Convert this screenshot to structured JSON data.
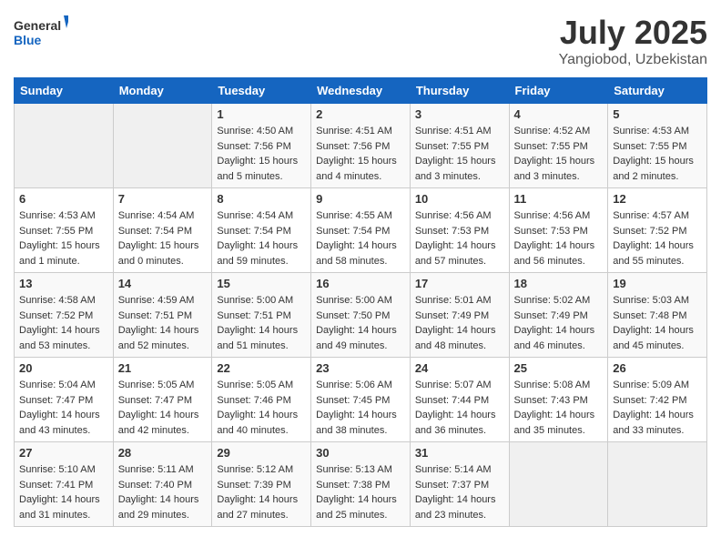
{
  "header": {
    "logo_line1": "General",
    "logo_line2": "Blue",
    "month": "July 2025",
    "location": "Yangiobod, Uzbekistan"
  },
  "days_of_week": [
    "Sunday",
    "Monday",
    "Tuesday",
    "Wednesday",
    "Thursday",
    "Friday",
    "Saturday"
  ],
  "weeks": [
    [
      {
        "day": "",
        "empty": true
      },
      {
        "day": "",
        "empty": true
      },
      {
        "day": "1",
        "sunrise": "Sunrise: 4:50 AM",
        "sunset": "Sunset: 7:56 PM",
        "daylight": "Daylight: 15 hours and 5 minutes."
      },
      {
        "day": "2",
        "sunrise": "Sunrise: 4:51 AM",
        "sunset": "Sunset: 7:56 PM",
        "daylight": "Daylight: 15 hours and 4 minutes."
      },
      {
        "day": "3",
        "sunrise": "Sunrise: 4:51 AM",
        "sunset": "Sunset: 7:55 PM",
        "daylight": "Daylight: 15 hours and 3 minutes."
      },
      {
        "day": "4",
        "sunrise": "Sunrise: 4:52 AM",
        "sunset": "Sunset: 7:55 PM",
        "daylight": "Daylight: 15 hours and 3 minutes."
      },
      {
        "day": "5",
        "sunrise": "Sunrise: 4:53 AM",
        "sunset": "Sunset: 7:55 PM",
        "daylight": "Daylight: 15 hours and 2 minutes."
      }
    ],
    [
      {
        "day": "6",
        "sunrise": "Sunrise: 4:53 AM",
        "sunset": "Sunset: 7:55 PM",
        "daylight": "Daylight: 15 hours and 1 minute."
      },
      {
        "day": "7",
        "sunrise": "Sunrise: 4:54 AM",
        "sunset": "Sunset: 7:54 PM",
        "daylight": "Daylight: 15 hours and 0 minutes."
      },
      {
        "day": "8",
        "sunrise": "Sunrise: 4:54 AM",
        "sunset": "Sunset: 7:54 PM",
        "daylight": "Daylight: 14 hours and 59 minutes."
      },
      {
        "day": "9",
        "sunrise": "Sunrise: 4:55 AM",
        "sunset": "Sunset: 7:54 PM",
        "daylight": "Daylight: 14 hours and 58 minutes."
      },
      {
        "day": "10",
        "sunrise": "Sunrise: 4:56 AM",
        "sunset": "Sunset: 7:53 PM",
        "daylight": "Daylight: 14 hours and 57 minutes."
      },
      {
        "day": "11",
        "sunrise": "Sunrise: 4:56 AM",
        "sunset": "Sunset: 7:53 PM",
        "daylight": "Daylight: 14 hours and 56 minutes."
      },
      {
        "day": "12",
        "sunrise": "Sunrise: 4:57 AM",
        "sunset": "Sunset: 7:52 PM",
        "daylight": "Daylight: 14 hours and 55 minutes."
      }
    ],
    [
      {
        "day": "13",
        "sunrise": "Sunrise: 4:58 AM",
        "sunset": "Sunset: 7:52 PM",
        "daylight": "Daylight: 14 hours and 53 minutes."
      },
      {
        "day": "14",
        "sunrise": "Sunrise: 4:59 AM",
        "sunset": "Sunset: 7:51 PM",
        "daylight": "Daylight: 14 hours and 52 minutes."
      },
      {
        "day": "15",
        "sunrise": "Sunrise: 5:00 AM",
        "sunset": "Sunset: 7:51 PM",
        "daylight": "Daylight: 14 hours and 51 minutes."
      },
      {
        "day": "16",
        "sunrise": "Sunrise: 5:00 AM",
        "sunset": "Sunset: 7:50 PM",
        "daylight": "Daylight: 14 hours and 49 minutes."
      },
      {
        "day": "17",
        "sunrise": "Sunrise: 5:01 AM",
        "sunset": "Sunset: 7:49 PM",
        "daylight": "Daylight: 14 hours and 48 minutes."
      },
      {
        "day": "18",
        "sunrise": "Sunrise: 5:02 AM",
        "sunset": "Sunset: 7:49 PM",
        "daylight": "Daylight: 14 hours and 46 minutes."
      },
      {
        "day": "19",
        "sunrise": "Sunrise: 5:03 AM",
        "sunset": "Sunset: 7:48 PM",
        "daylight": "Daylight: 14 hours and 45 minutes."
      }
    ],
    [
      {
        "day": "20",
        "sunrise": "Sunrise: 5:04 AM",
        "sunset": "Sunset: 7:47 PM",
        "daylight": "Daylight: 14 hours and 43 minutes."
      },
      {
        "day": "21",
        "sunrise": "Sunrise: 5:05 AM",
        "sunset": "Sunset: 7:47 PM",
        "daylight": "Daylight: 14 hours and 42 minutes."
      },
      {
        "day": "22",
        "sunrise": "Sunrise: 5:05 AM",
        "sunset": "Sunset: 7:46 PM",
        "daylight": "Daylight: 14 hours and 40 minutes."
      },
      {
        "day": "23",
        "sunrise": "Sunrise: 5:06 AM",
        "sunset": "Sunset: 7:45 PM",
        "daylight": "Daylight: 14 hours and 38 minutes."
      },
      {
        "day": "24",
        "sunrise": "Sunrise: 5:07 AM",
        "sunset": "Sunset: 7:44 PM",
        "daylight": "Daylight: 14 hours and 36 minutes."
      },
      {
        "day": "25",
        "sunrise": "Sunrise: 5:08 AM",
        "sunset": "Sunset: 7:43 PM",
        "daylight": "Daylight: 14 hours and 35 minutes."
      },
      {
        "day": "26",
        "sunrise": "Sunrise: 5:09 AM",
        "sunset": "Sunset: 7:42 PM",
        "daylight": "Daylight: 14 hours and 33 minutes."
      }
    ],
    [
      {
        "day": "27",
        "sunrise": "Sunrise: 5:10 AM",
        "sunset": "Sunset: 7:41 PM",
        "daylight": "Daylight: 14 hours and 31 minutes."
      },
      {
        "day": "28",
        "sunrise": "Sunrise: 5:11 AM",
        "sunset": "Sunset: 7:40 PM",
        "daylight": "Daylight: 14 hours and 29 minutes."
      },
      {
        "day": "29",
        "sunrise": "Sunrise: 5:12 AM",
        "sunset": "Sunset: 7:39 PM",
        "daylight": "Daylight: 14 hours and 27 minutes."
      },
      {
        "day": "30",
        "sunrise": "Sunrise: 5:13 AM",
        "sunset": "Sunset: 7:38 PM",
        "daylight": "Daylight: 14 hours and 25 minutes."
      },
      {
        "day": "31",
        "sunrise": "Sunrise: 5:14 AM",
        "sunset": "Sunset: 7:37 PM",
        "daylight": "Daylight: 14 hours and 23 minutes."
      },
      {
        "day": "",
        "empty": true
      },
      {
        "day": "",
        "empty": true
      }
    ]
  ]
}
